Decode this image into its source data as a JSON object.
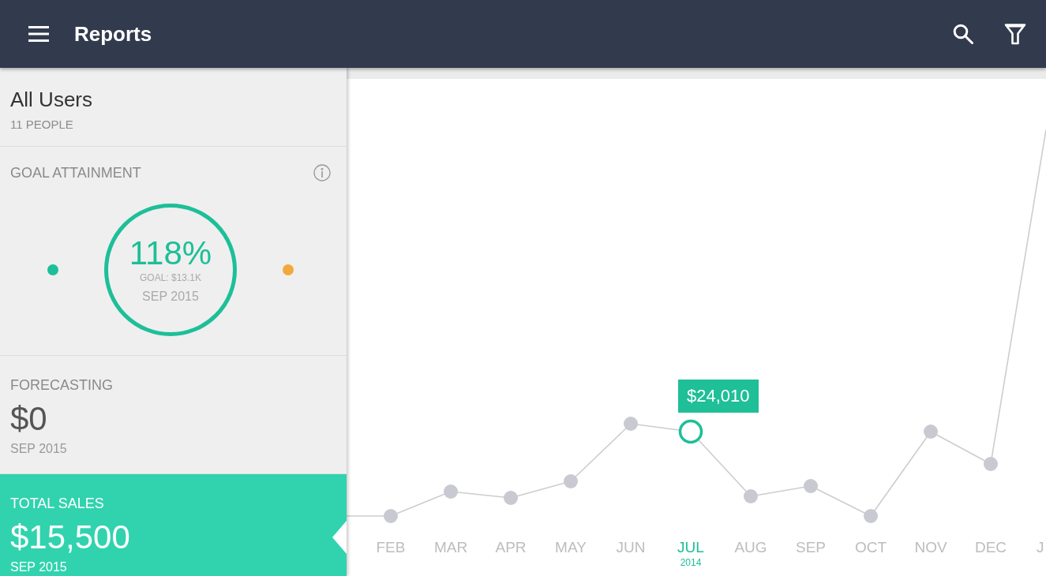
{
  "app_bar": {
    "title": "Reports"
  },
  "user_group": {
    "name": "All Users",
    "count": "11 PEOPLE"
  },
  "metrics": [
    {
      "kind": "ring",
      "title": "GOAL ATTAINMENT",
      "value": "118%",
      "goal": "GOAL: $13.1K",
      "period": "SEP 2015",
      "selected": false,
      "markers": [
        {
          "color": "#1dbf98"
        },
        {
          "color": "#f2a93b"
        }
      ]
    },
    {
      "kind": "figure",
      "title": "FORECASTING",
      "value": "$0",
      "period": "SEP 2015",
      "selected": false
    },
    {
      "kind": "figure",
      "title": "TOTAL SALES",
      "value": "$15,500",
      "period": "SEP 2015",
      "selected": true
    }
  ],
  "chart": {
    "tooltip": "$24,010",
    "months": [
      {
        "label": "FEB",
        "selected": false
      },
      {
        "label": "MAR",
        "selected": false
      },
      {
        "label": "APR",
        "selected": false
      },
      {
        "label": "MAY",
        "selected": false
      },
      {
        "label": "JUN",
        "selected": false
      },
      {
        "label": "JUL",
        "selected": true,
        "year": "2014"
      },
      {
        "label": "AUG",
        "selected": false
      },
      {
        "label": "SEP",
        "selected": false
      },
      {
        "label": "OCT",
        "selected": false
      },
      {
        "label": "NOV",
        "selected": false
      },
      {
        "label": "DEC",
        "selected": false
      },
      {
        "label": "J",
        "selected": false
      }
    ]
  }
}
